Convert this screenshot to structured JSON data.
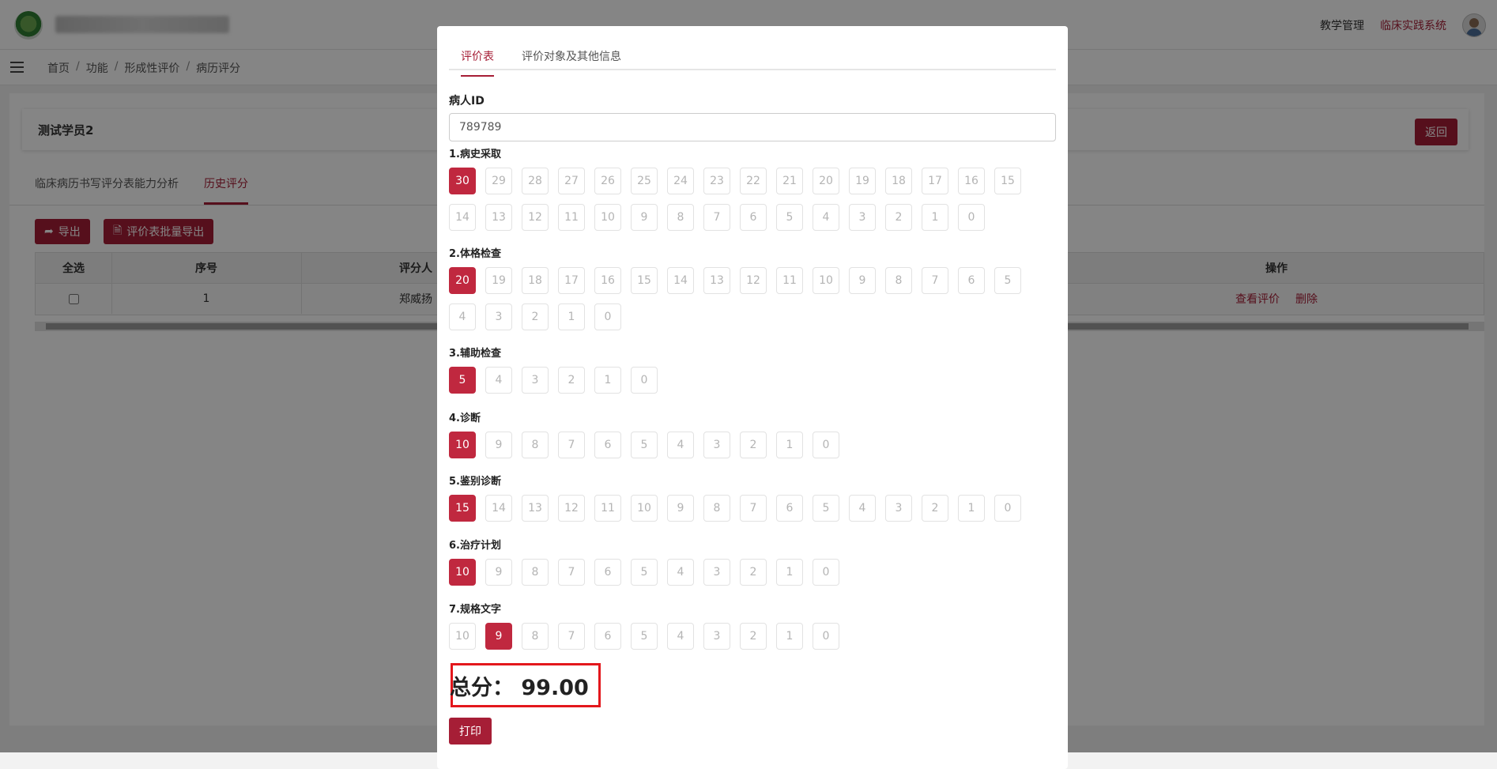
{
  "header": {
    "nav": [
      "教学管理",
      "临床实践系统"
    ]
  },
  "breadcrumb": [
    "首页",
    "功能",
    "形成性评价",
    "病历评分"
  ],
  "page": {
    "student": "测试学员2",
    "back_label": "返回",
    "tabs": [
      "临床病历书写评分表能力分析",
      "历史评分"
    ],
    "actions": {
      "export": "导出",
      "batch_export": "评价表批量导出"
    },
    "table": {
      "headers": [
        "全选",
        "序号",
        "评分人",
        "操作"
      ],
      "rows": [
        {
          "index": "1",
          "rater": "郑威扬",
          "view": "查看评价",
          "delete": "删除"
        }
      ]
    }
  },
  "modal": {
    "tabs": [
      "评价表",
      "评价对象及其他信息"
    ],
    "patient_id_label": "病人ID",
    "patient_id_value": "789789",
    "sections": [
      {
        "label": "1.病史采取",
        "max": 30,
        "selected": 30
      },
      {
        "label": "2.体格检查",
        "max": 20,
        "selected": 20
      },
      {
        "label": "3.辅助检查",
        "max": 5,
        "selected": 5
      },
      {
        "label": "4.诊断",
        "max": 10,
        "selected": 10
      },
      {
        "label": "5.鉴别诊断",
        "max": 15,
        "selected": 15
      },
      {
        "label": "6.治疗计划",
        "max": 10,
        "selected": 10
      },
      {
        "label": "7.规格文字",
        "max": 10,
        "selected": 9
      }
    ],
    "total": "总分：  99.00",
    "print_label": "打印"
  },
  "colors": {
    "accent": "#a61e36",
    "selected": "#c0283f",
    "highlight": "#e3171c"
  }
}
